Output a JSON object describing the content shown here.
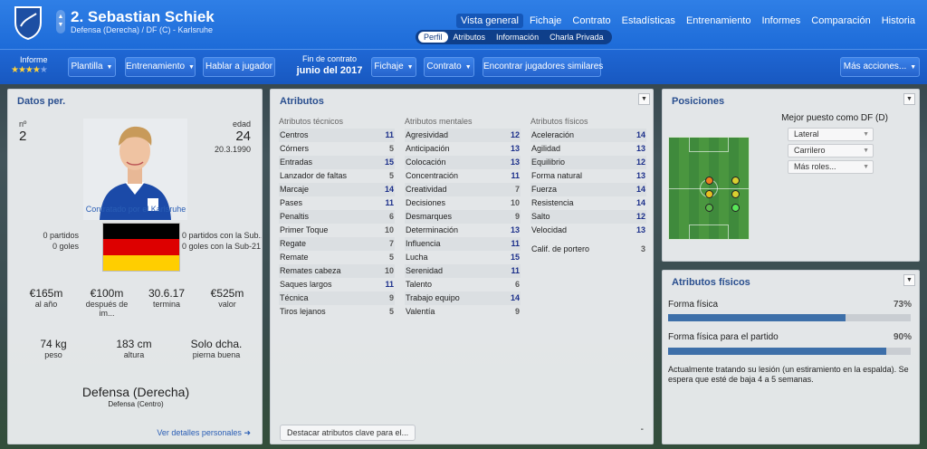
{
  "header": {
    "player_name": "2. Sebastian Schiek",
    "player_sub": "Defensa (Derecha) / DF (C) - Karlsruhe",
    "nav": [
      "Vista general",
      "Fichaje",
      "Contrato",
      "Estadísticas",
      "Entrenamiento",
      "Informes",
      "Comparación",
      "Historia"
    ],
    "nav_active": "Vista general",
    "subnav": [
      "Perfil",
      "Atributos",
      "Información",
      "Charla Privada"
    ],
    "subnav_active": "Perfil"
  },
  "toolbar": {
    "informe_label": "Informe",
    "stars": 3.5,
    "plantilla": "Plantilla",
    "entrenamiento": "Entrenamiento",
    "hablar": "Hablar a jugador",
    "contract_label": "Fin de contrato",
    "contract_value": "junio del 2017",
    "fichaje": "Fichaje",
    "contrato": "Contrato",
    "similares": "Encontrar jugadores similares",
    "mas": "Más acciones..."
  },
  "personal": {
    "title": "Datos per.",
    "num_label": "nº",
    "num": "2",
    "age_label": "edad",
    "age": "24",
    "dob": "20.3.1990",
    "club_status": "Contratado por el Karlsruhe",
    "left_stats": [
      "0 partidos",
      "0 goles"
    ],
    "right_stats": [
      "0 partidos con la Sub...",
      "0 goles con la Sub-21"
    ],
    "money": [
      {
        "v": "€165m",
        "l": "al año"
      },
      {
        "v": "€100m",
        "l": "después de im..."
      },
      {
        "v": "30.6.17",
        "l": "termina"
      },
      {
        "v": "€525m",
        "l": "valor"
      }
    ],
    "phys": [
      {
        "v": "74 kg",
        "l": "peso"
      },
      {
        "v": "183 cm",
        "l": "altura"
      },
      {
        "v": "Solo dcha.",
        "l": "pierna buena"
      }
    ],
    "position": "Defensa (Derecha)",
    "position_sub": "Defensa (Centro)",
    "details_link": "Ver detalles personales"
  },
  "attributes": {
    "title": "Atributos",
    "tech_title": "Atributos técnicos",
    "mental_title": "Atributos mentales",
    "phys_title": "Atributos físicos",
    "technical": [
      [
        "Centros",
        "11"
      ],
      [
        "Córners",
        "5"
      ],
      [
        "Entradas",
        "15"
      ],
      [
        "Lanzador de faltas",
        "5"
      ],
      [
        "Marcaje",
        "14"
      ],
      [
        "Pases",
        "11"
      ],
      [
        "Penaltis",
        "6"
      ],
      [
        "Primer Toque",
        "10"
      ],
      [
        "Regate",
        "7"
      ],
      [
        "Remate",
        "5"
      ],
      [
        "Remates cabeza",
        "10"
      ],
      [
        "Saques largos",
        "11"
      ],
      [
        "Técnica",
        "9"
      ],
      [
        "Tiros lejanos",
        "5"
      ]
    ],
    "mental": [
      [
        "Agresividad",
        "12"
      ],
      [
        "Anticipación",
        "13"
      ],
      [
        "Colocación",
        "13"
      ],
      [
        "Concentración",
        "11"
      ],
      [
        "Creatividad",
        "7"
      ],
      [
        "Decisiones",
        "10"
      ],
      [
        "Desmarques",
        "9"
      ],
      [
        "Determinación",
        "13"
      ],
      [
        "Influencia",
        "11"
      ],
      [
        "Lucha",
        "15"
      ],
      [
        "Serenidad",
        "11"
      ],
      [
        "Talento",
        "6"
      ],
      [
        "Trabajo equipo",
        "14"
      ],
      [
        "Valentía",
        "9"
      ]
    ],
    "physical": [
      [
        "Aceleración",
        "14"
      ],
      [
        "Agilidad",
        "13"
      ],
      [
        "Equilibrio",
        "12"
      ],
      [
        "Forma natural",
        "13"
      ],
      [
        "Fuerza",
        "14"
      ],
      [
        "Resistencia",
        "14"
      ],
      [
        "Salto",
        "12"
      ],
      [
        "Velocidad",
        "13"
      ]
    ],
    "gk": [
      "Calif. de portero",
      "3"
    ],
    "highlight": "Destacar atributos clave para el...",
    "dash": "-"
  },
  "positions": {
    "title": "Posiciones",
    "best": "Mejor puesto como DF (D)",
    "roles": [
      "Lateral",
      "Carrilero",
      "Más roles..."
    ]
  },
  "fitness": {
    "title": "Atributos físicos",
    "forma": "Forma física",
    "forma_pct": "73%",
    "forma_val": 0.73,
    "partido": "Forma física para el partido",
    "partido_pct": "90%",
    "partido_val": 0.9,
    "note": "Actualmente tratando su lesión (un estiramiento en la espalda). Se espera que esté de baja 4 a 5 semanas."
  },
  "colors": {
    "accent": "#1d6bd8",
    "title": "#2a4f8f",
    "attr_high": "#1b2f8a"
  }
}
